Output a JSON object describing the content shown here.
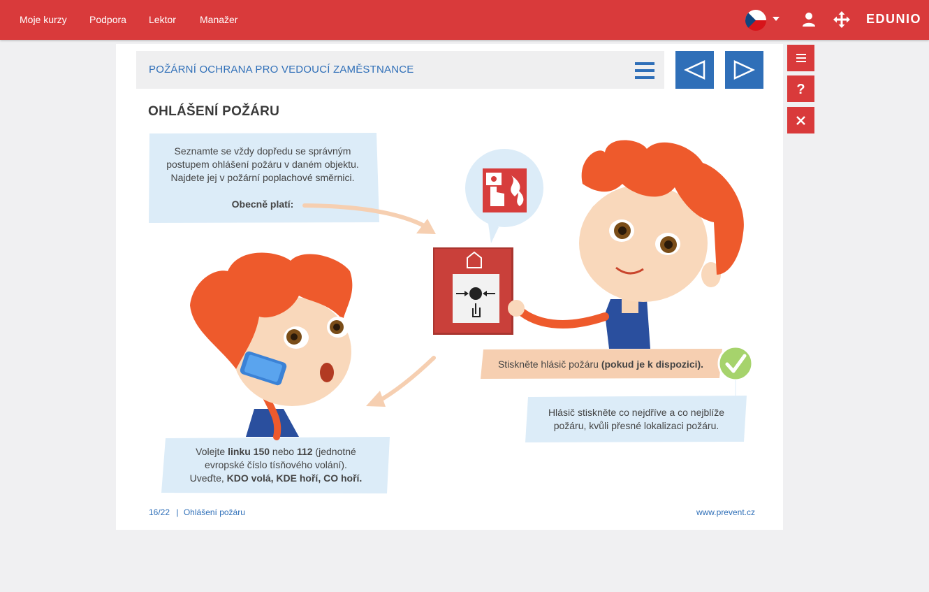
{
  "topbar": {
    "nav": [
      "Moje kurzy",
      "Podpora",
      "Lektor",
      "Manažer"
    ],
    "brand": "EDUNIO",
    "icons": [
      "czech-flag-icon",
      "user-icon",
      "move-icon"
    ]
  },
  "course": {
    "title": "POŽÁRNÍ OCHRANA PRO VEDOUCÍ ZAMĚSTNANCE"
  },
  "slide": {
    "heading": "OHLÁŠENÍ POŽÁRU",
    "box1": {
      "line1": "Seznamte se vždy dopředu se správným",
      "line2": "postupem ohlášení požáru v daném objektu.",
      "line3": "Najdete jej v požární poplachové směrnici.",
      "bold": "Obecně platí:"
    },
    "box2": {
      "pre": "Stiskněte hlásič požáru ",
      "bold": "(pokud je k dispozici)."
    },
    "box3": {
      "line1": "Hlásič stiskněte co nejdříve a co nejblíže",
      "line2": "požáru, kvůli přesné lokalizaci požáru."
    },
    "box4": {
      "t1": "Volejte ",
      "b1": "linku 150",
      "t2": " nebo ",
      "b2": "112",
      "t3": " (jednotné",
      "line2": "evropské číslo tísňového volání).",
      "t4": "Uveďte, ",
      "b3": "KDO volá, KDE hoří, CO hoří."
    },
    "footer": {
      "page": "16/22",
      "separator": "|",
      "section": "Ohlášení požáru",
      "site": "www.prevent.cz"
    }
  },
  "colors": {
    "brand_red": "#d93a3b",
    "nav_blue": "#2f6fb8",
    "bubble_blue": "#dcecf8",
    "bubble_peach": "#f6cfb1",
    "hair": "#ee5a2c",
    "check_green": "#a6d36c"
  }
}
